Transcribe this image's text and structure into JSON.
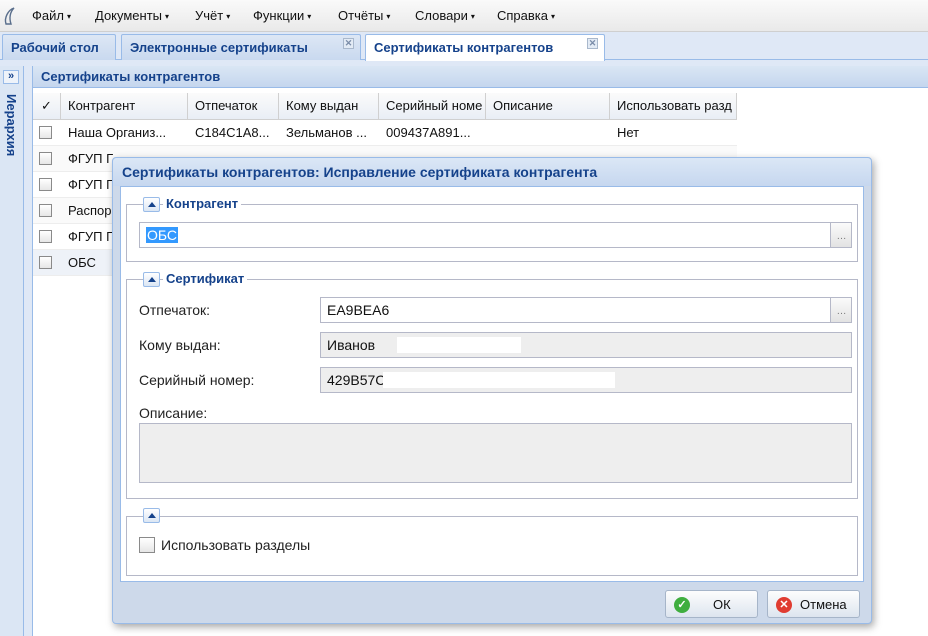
{
  "menu": {
    "items": [
      {
        "label": "Файл"
      },
      {
        "label": "Документы"
      },
      {
        "label": "Учёт"
      },
      {
        "label": "Функции"
      },
      {
        "label": "Отчёты"
      },
      {
        "label": "Словари"
      },
      {
        "label": "Справка"
      }
    ],
    "arrow_icon": "▾"
  },
  "tabs": [
    {
      "label": "Рабочий стол",
      "closable": false
    },
    {
      "label": "Электронные сертификаты",
      "closable": true
    },
    {
      "label": "Сертификаты контрагентов",
      "closable": true,
      "active": true
    }
  ],
  "tab_close_icon": "✕",
  "side_panel": {
    "label": "Иерархия",
    "expand_icon": "»"
  },
  "panel": {
    "title": "Сертификаты контрагентов",
    "columns": [
      {
        "label": "✓"
      },
      {
        "label": "Контрагент"
      },
      {
        "label": "Отпечаток"
      },
      {
        "label": "Кому выдан"
      },
      {
        "label": "Серийный номе"
      },
      {
        "label": "Описание"
      },
      {
        "label": "Использовать разд"
      }
    ],
    "rows": [
      {
        "contragent": "Наша Организ...",
        "fingerprint": "C184C1A8...",
        "issued_to": "Зельманов ...",
        "serial": "009437A891...",
        "description": "",
        "use_sections": "Нет"
      },
      {
        "contragent": "ФГУП Г",
        "fingerprint": "",
        "issued_to": "",
        "serial": "",
        "description": "",
        "use_sections": ""
      },
      {
        "contragent": "ФГУП Г",
        "fingerprint": "",
        "issued_to": "",
        "serial": "",
        "description": "",
        "use_sections": ""
      },
      {
        "contragent": "Распор",
        "fingerprint": "",
        "issued_to": "",
        "serial": "",
        "description": "",
        "use_sections": ""
      },
      {
        "contragent": "ФГУП Г",
        "fingerprint": "",
        "issued_to": "",
        "serial": "",
        "description": "",
        "use_sections": ""
      },
      {
        "contragent": "ОБС",
        "fingerprint": "",
        "issued_to": "",
        "serial": "",
        "description": "",
        "use_sections": ""
      }
    ]
  },
  "dialog": {
    "title": "Сертификаты контрагентов: Исправление сертификата контрагента",
    "contragent_section": {
      "legend": "Контрагент",
      "value": "ОБС"
    },
    "certificate_section": {
      "legend": "Сертификат",
      "fingerprint_label": "Отпечаток:",
      "fingerprint_value": "EA9BEA6⁢",
      "issued_to_label": "Кому выдан:",
      "issued_to_value": "Иванов",
      "serial_label": "Серийный номер:",
      "serial_value": "429B57C",
      "description_label": "Описание:",
      "description_value": ""
    },
    "options_section": {
      "use_sections_label": "Использовать разделы",
      "use_sections_checked": false
    },
    "trigger_icon": "…",
    "ok_label": "ОК",
    "cancel_label": "Отмена",
    "ok_icon": "✓",
    "cancel_icon": "✕",
    "colors": {
      "ok_icon": "#3fae3f",
      "cancel_icon": "#e03c31",
      "header_text": "#15428b"
    }
  }
}
